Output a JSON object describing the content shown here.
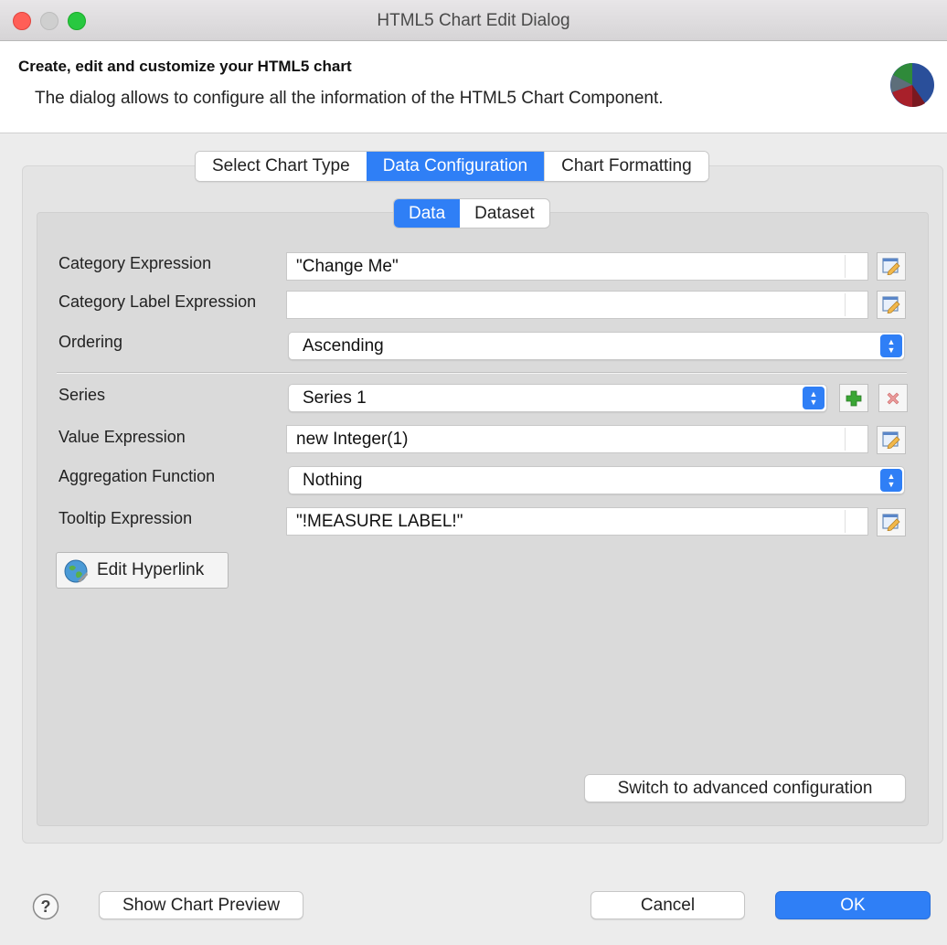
{
  "window": {
    "title": "HTML5 Chart Edit Dialog"
  },
  "header": {
    "title": "Create, edit and customize your HTML5 chart",
    "description": "The dialog allows to configure all the information of the HTML5 Chart Component.",
    "logo_icon": "pie-chart-icon"
  },
  "tabs": [
    {
      "label": "Select Chart Type",
      "active": false
    },
    {
      "label": "Data Configuration",
      "active": true
    },
    {
      "label": "Chart Formatting",
      "active": false
    }
  ],
  "subtabs": [
    {
      "label": "Data",
      "active": true
    },
    {
      "label": "Dataset",
      "active": false
    }
  ],
  "form": {
    "category_expression": {
      "label": "Category Expression",
      "value": "\"Change Me\""
    },
    "category_label_expression": {
      "label": "Category Label Expression",
      "value": ""
    },
    "ordering": {
      "label": "Ordering",
      "value": "Ascending"
    },
    "series": {
      "label": "Series",
      "value": "Series 1"
    },
    "value_expression": {
      "label": "Value Expression",
      "value": "new Integer(1)"
    },
    "aggregation_function": {
      "label": "Aggregation Function",
      "value": "Nothing"
    },
    "tooltip_expression": {
      "label": "Tooltip Expression",
      "value": "\"!MEASURE LABEL!\""
    }
  },
  "buttons": {
    "edit_hyperlink": "Edit Hyperlink",
    "switch_advanced": "Switch to advanced configuration",
    "show_preview": "Show Chart Preview",
    "cancel": "Cancel",
    "ok": "OK",
    "help": "?"
  },
  "colors": {
    "accent": "#2f7ff6",
    "add_icon": "#3aa635",
    "remove_icon": "#e56b6b"
  }
}
